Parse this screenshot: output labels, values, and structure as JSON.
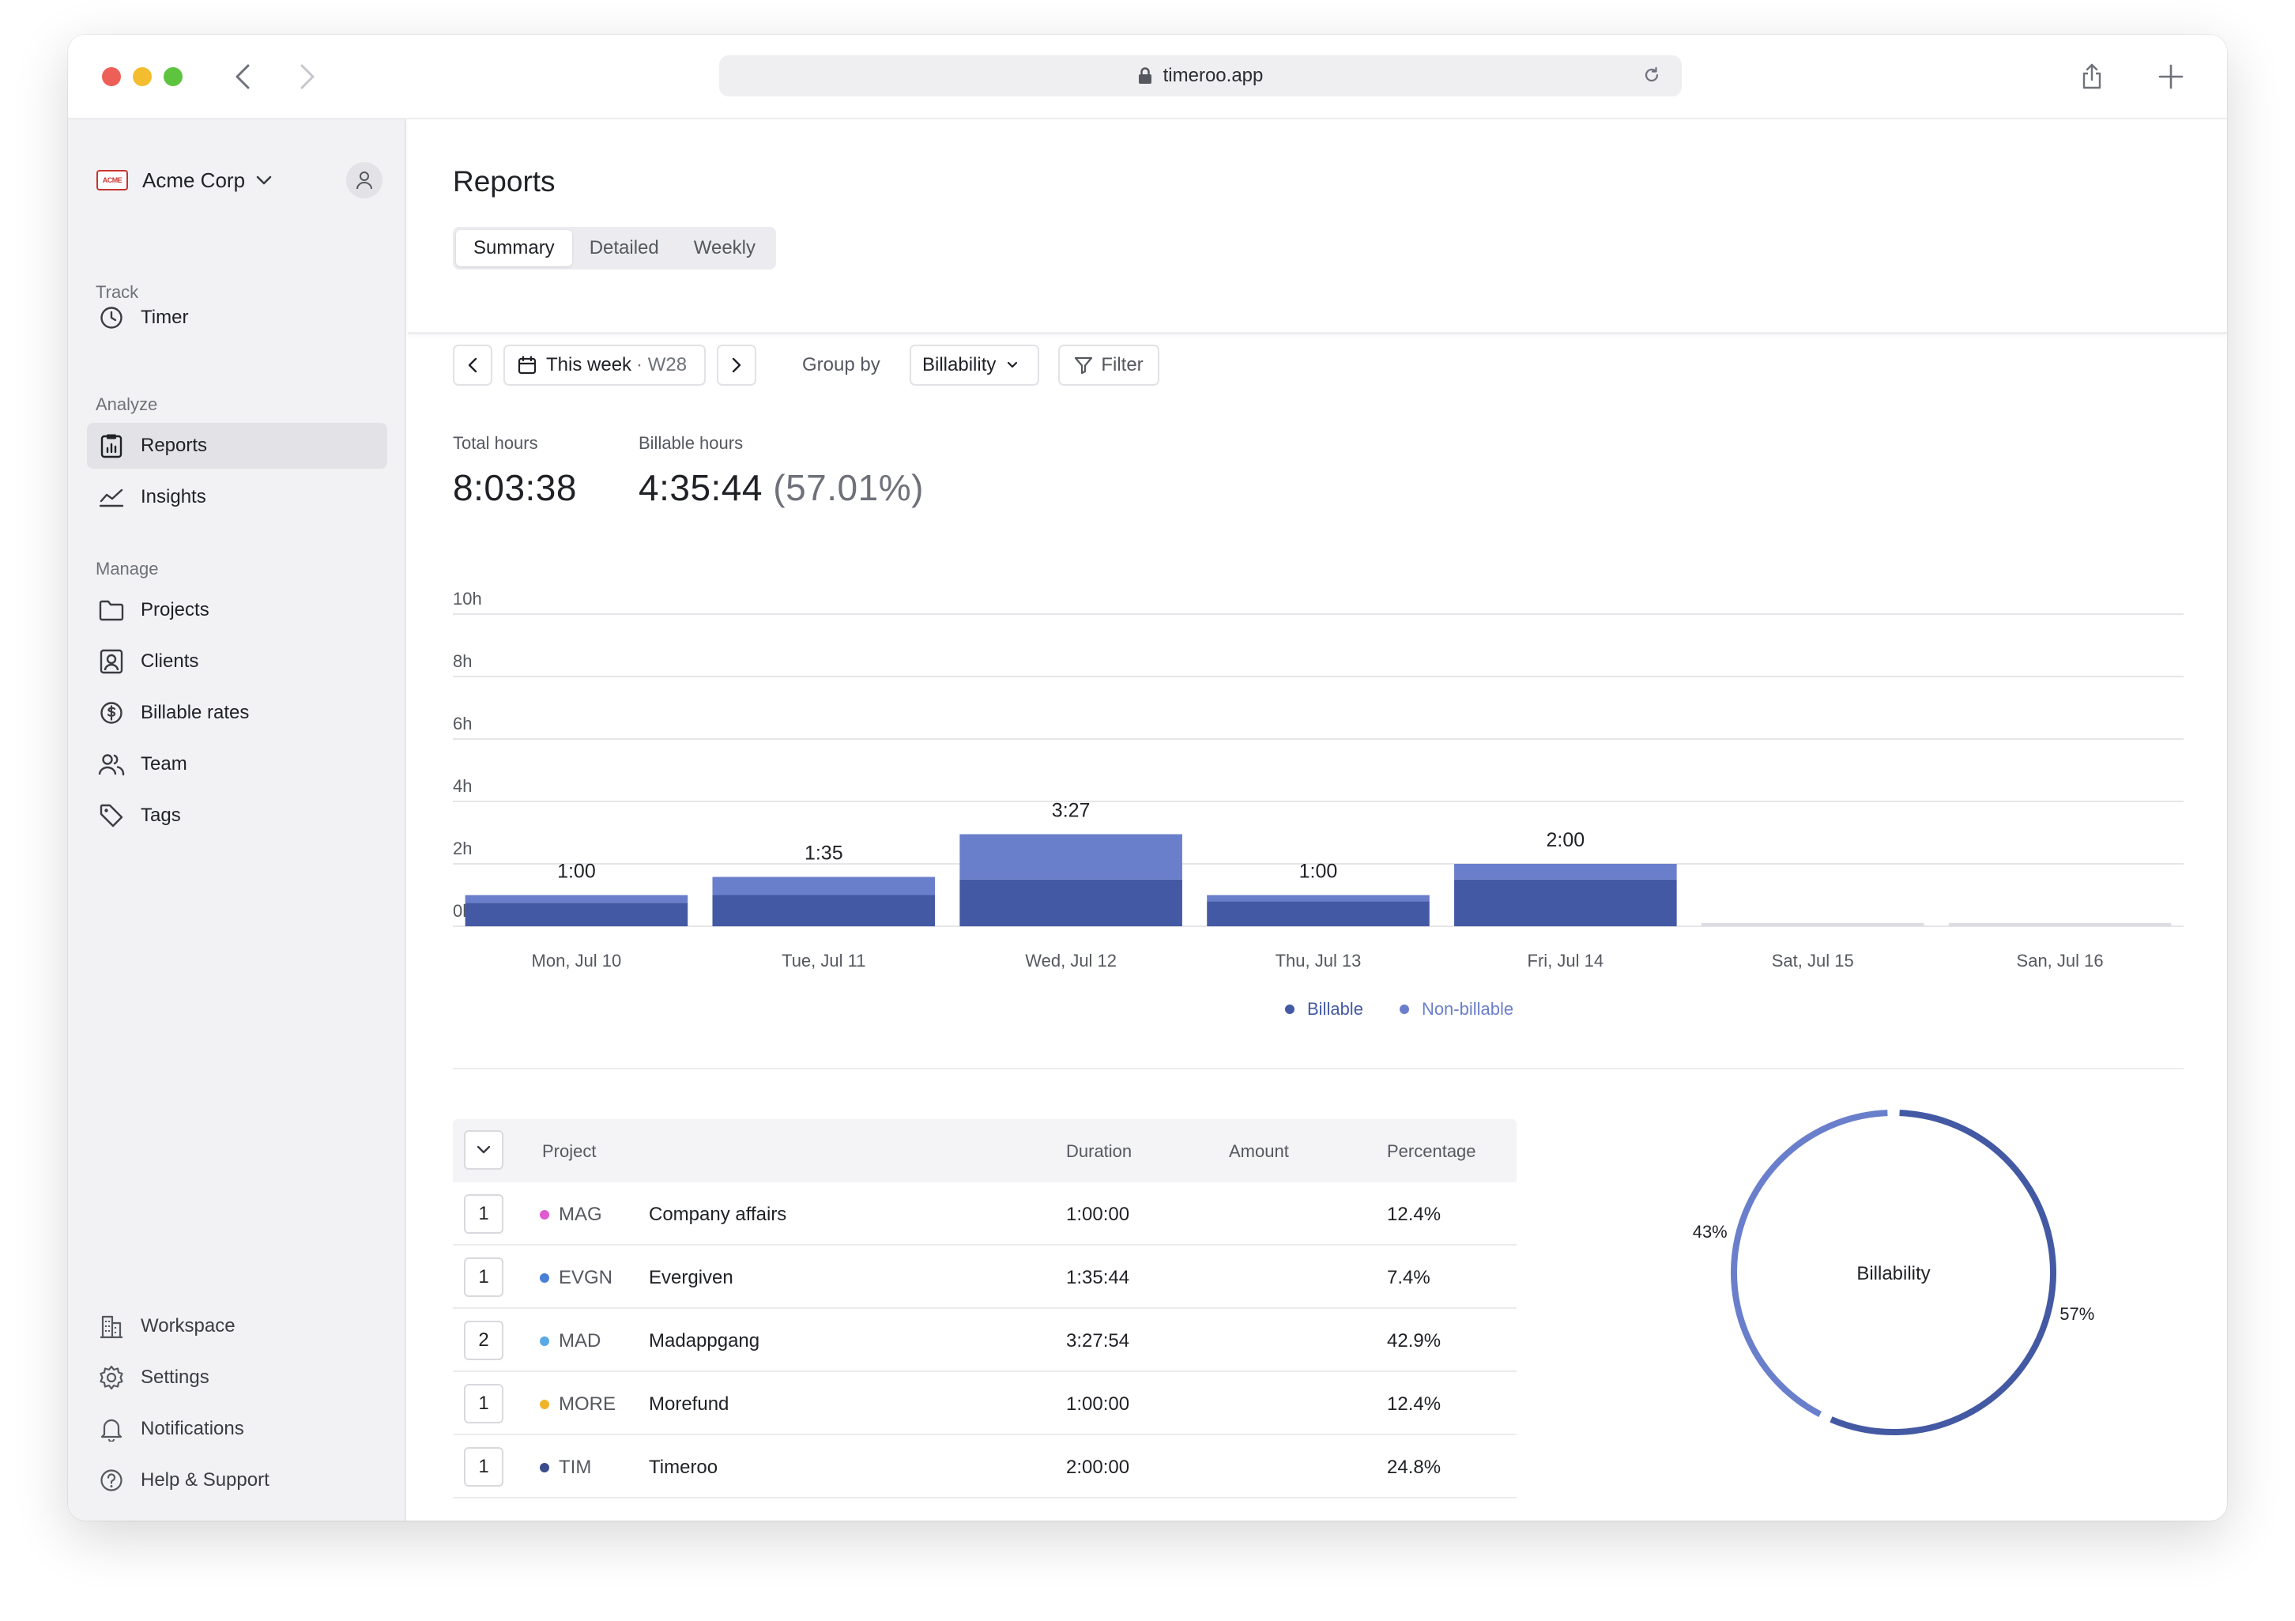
{
  "browser": {
    "url": "timeroo.app"
  },
  "sidebar": {
    "org_name": "Acme Corp",
    "org_logo_text": "ACME",
    "sections": {
      "track": "Track",
      "analyze": "Analyze",
      "manage": "Manage"
    },
    "items": {
      "timer": "Timer",
      "reports": "Reports",
      "insights": "Insights",
      "projects": "Projects",
      "clients": "Clients",
      "billable_rates": "Billable rates",
      "team": "Team",
      "tags": "Tags",
      "workspace": "Workspace",
      "settings": "Settings",
      "notifications": "Notifications",
      "help": "Help & Support"
    }
  },
  "page": {
    "title": "Reports",
    "tabs": [
      "Summary",
      "Detailed",
      "Weekly"
    ],
    "active_tab": "Summary"
  },
  "toolbar": {
    "week_label": "This week",
    "week_code": "· W28",
    "group_by_label": "Group by",
    "group_by_value": "Billability",
    "filter_label": "Filter"
  },
  "stats": {
    "total_label": "Total hours",
    "total_value": "8:03:38",
    "billable_label": "Billable hours",
    "billable_value": "4:35:44",
    "billable_pct": "(57.01%)"
  },
  "chart_data": {
    "type": "bar",
    "stacked": true,
    "categories": [
      "Mon, Jul 10",
      "Tue, Jul 11",
      "Wed, Jul 12",
      "Thu, Jul 13",
      "Fri, Jul 14",
      "Sat, Jul 15",
      "San, Jul 16"
    ],
    "totals_labels": [
      "1:00",
      "1:35",
      "3:27",
      "1:00",
      "2:00",
      "",
      ""
    ],
    "series": [
      {
        "name": "Billable",
        "color": "#4459a3",
        "values": [
          0.75,
          1.0,
          1.5,
          0.8,
          1.5,
          0,
          0
        ]
      },
      {
        "name": "Non-billable",
        "color": "#6a7fcb",
        "values": [
          0.25,
          0.58,
          1.45,
          0.2,
          0.5,
          0,
          0
        ]
      }
    ],
    "y_ticks": [
      "0h",
      "2h",
      "4h",
      "6h",
      "8h",
      "10h"
    ],
    "ylim": [
      0,
      10
    ],
    "grid": true,
    "legend": "bottom-center"
  },
  "table": {
    "headers": {
      "project": "Project",
      "duration": "Duration",
      "amount": "Amount",
      "percentage": "Percentage"
    },
    "rows": [
      {
        "count": "1",
        "code": "MAG",
        "name": "Company affairs",
        "duration": "1:00:00",
        "amount": "",
        "percentage": "12.4%",
        "color": "#e05ad0"
      },
      {
        "count": "1",
        "code": "EVGN",
        "name": "Evergiven",
        "duration": "1:35:44",
        "amount": "",
        "percentage": "7.4%",
        "color": "#4a7fd6"
      },
      {
        "count": "2",
        "code": "MAD",
        "name": "Madappgang",
        "duration": "3:27:54",
        "amount": "",
        "percentage": "42.9%",
        "color": "#5aa8e8"
      },
      {
        "count": "1",
        "code": "MORE",
        "name": "Morefund",
        "duration": "1:00:00",
        "amount": "",
        "percentage": "12.4%",
        "color": "#f0b429"
      },
      {
        "count": "1",
        "code": "TIM",
        "name": "Timeroo",
        "duration": "2:00:00",
        "amount": "",
        "percentage": "24.8%",
        "color": "#3a4a8c"
      }
    ]
  },
  "donut": {
    "title": "Billability",
    "slices": [
      {
        "label": "57%",
        "value": 57,
        "color": "#4459a3"
      },
      {
        "label": "43%",
        "value": 43,
        "color": "#6a7fcb"
      }
    ]
  }
}
